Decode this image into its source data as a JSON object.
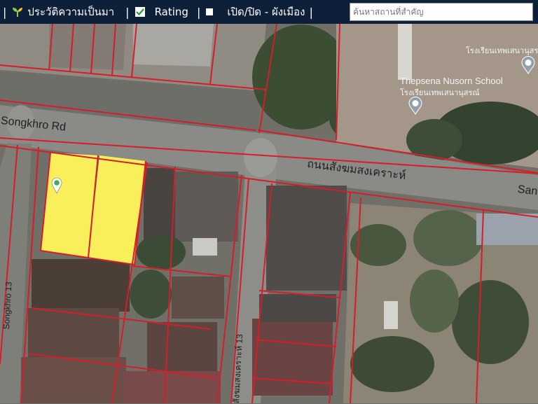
{
  "toolbar": {
    "history_label": "ประวัติความเป็นมา",
    "rating_label": "Rating",
    "zoning_label": "เปิด/ปิด - ผังเมือง",
    "separator": "|"
  },
  "search": {
    "placeholder": "ค้นหาสถานที่สำคัญ",
    "value": ""
  },
  "map": {
    "labels": {
      "road_en": "Songkhro Rd",
      "road_th": "ถนนสังฆมสงเคราะห์",
      "road_en_right": "San",
      "school_en": "Thepsena Nusorn School",
      "school_th": "โรงเรียนเทพเสนานุสรณ์",
      "school_th_top": "โรงเรียนเทพเสนานุสรณ์",
      "soi_right": "สังฆมสงเคราะห์ 13",
      "soi_left": "Songkhro 13"
    },
    "colors": {
      "parcel_highlight": "#f9ef5a",
      "parcel_lines": "#d61d2a",
      "toolbar_bg": "#0e1f3a"
    },
    "icons": [
      "sprout-icon",
      "checkbox-checked-icon",
      "checkbox-icon",
      "location-pin-icon",
      "school-pin-icon"
    ]
  }
}
